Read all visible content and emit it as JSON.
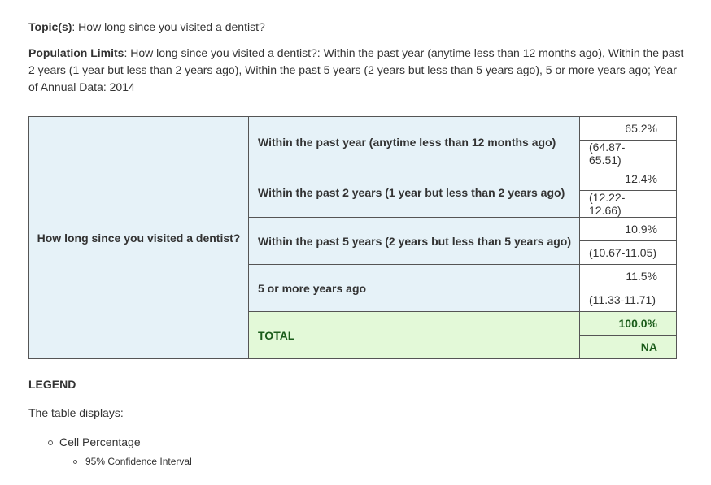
{
  "topic": {
    "label": "Topic(s)",
    "value": ": How long since you visited a dentist?"
  },
  "population_limits": {
    "label": "Population Limits",
    "value": ": How long since you visited a dentist?: Within the past year (anytime less than 12 months ago), Within the past 2 years (1 year but less than 2 years ago), Within the past 5 years (2 years but less than 5 years ago), 5 or more years ago; Year of Annual Data: 2014"
  },
  "table": {
    "row_header": "How long since you visited a dentist?",
    "rows": [
      {
        "category": "Within the past year (anytime less than 12 months ago)",
        "percent": "65.2%",
        "ci": "(64.87-65.51)"
      },
      {
        "category": "Within the past 2 years (1 year but less than 2 years ago)",
        "percent": "12.4%",
        "ci": "(12.22-12.66)"
      },
      {
        "category": "Within the past 5 years (2 years but less than 5 years ago)",
        "percent": "10.9%",
        "ci": "(10.67-11.05)"
      },
      {
        "category": "5 or more years ago",
        "percent": "11.5%",
        "ci": "(11.33-11.71)"
      }
    ],
    "total": {
      "category": "TOTAL",
      "percent": "100.0%",
      "ci": "NA"
    }
  },
  "legend": {
    "title": "LEGEND",
    "description": "The table displays:",
    "item_level1": "Cell Percentage",
    "item_level2": "95% Confidence Interval"
  },
  "colors": {
    "category_bg": "#e6f2f8",
    "total_bg": "#e3f9d8",
    "total_text": "#1a5c1a"
  }
}
